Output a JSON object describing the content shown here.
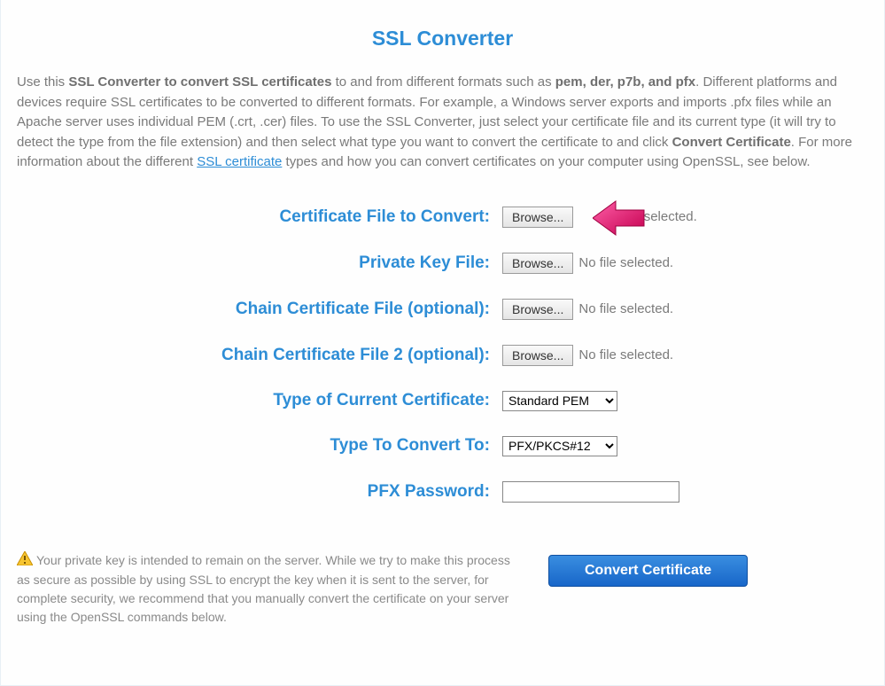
{
  "header": {
    "title": "SSL Converter"
  },
  "intro": {
    "p1a": "Use this ",
    "b1": "SSL Converter to convert SSL certificates",
    "p1b": " to and from different formats such as ",
    "b2": "pem, der, p7b, and pfx",
    "p1c": ". Different platforms and devices require SSL certificates to be converted to different formats. For example, a Windows server exports and imports .pfx files while an Apache server uses individual PEM (.crt, .cer) files. To use the SSL Converter, just select your certificate file and its current type (it will try to detect the type from the file extension) and then select what type you want to convert the certificate to and click ",
    "b3": "Convert Certificate",
    "p1d": ". For more information about the different ",
    "link": "SSL certificate",
    "p1e": " types and how you can convert certificates on your computer using OpenSSL, see below."
  },
  "form": {
    "rows": [
      {
        "label": "Certificate File to Convert:",
        "browse": "Browse...",
        "status": "file selected."
      },
      {
        "label": "Private Key File:",
        "browse": "Browse...",
        "status": "No file selected."
      },
      {
        "label": "Chain Certificate File (optional):",
        "browse": "Browse...",
        "status": "No file selected."
      },
      {
        "label": "Chain Certificate File 2 (optional):",
        "browse": "Browse...",
        "status": "No file selected."
      }
    ],
    "current_type": {
      "label": "Type of Current Certificate:",
      "value": "Standard PEM"
    },
    "convert_to": {
      "label": "Type To Convert To:",
      "value": "PFX/PKCS#12"
    },
    "pfx_password": {
      "label": "PFX Password:",
      "value": ""
    }
  },
  "footer": {
    "note": "Your private key is intended to remain on the server. While we try to make this process as secure as possible by using SSL to encrypt the key when it is sent to the server, for complete security, we recommend that you manually convert the certificate on your server using the OpenSSL commands below.",
    "button": "Convert Certificate"
  }
}
